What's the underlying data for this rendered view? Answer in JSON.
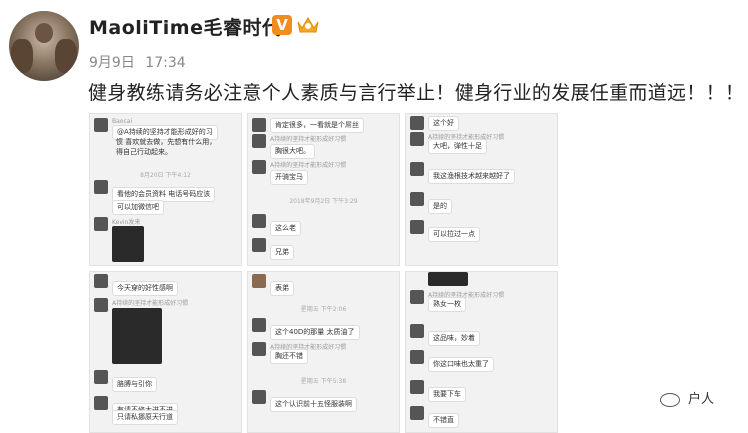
{
  "user": {
    "name": "MaoliTime毛睿时代",
    "verified_mark": "V"
  },
  "meta": {
    "date": "9月9日",
    "time": "17:34"
  },
  "post": {
    "text": "健身教练请务必注意个人素质与言行举止！健身行业的发展任重而道远！！！"
  },
  "screenshots": [
    {
      "msgs": [
        {
          "meta": "Baocai",
          "text": "@A持续的坚持才能形成好的习"
        },
        {
          "meta": "",
          "text": "惯 喜欢就去做，先想有什么用，"
        },
        {
          "meta": "",
          "text": "得自己行动起来。"
        },
        {
          "meta": "8月20日 下午4:12",
          "text": ""
        },
        {
          "meta": "",
          "text": "看他的会员资料 电话号码应该"
        },
        {
          "meta": "",
          "text": "可以加微信吧"
        },
        {
          "meta": "Kevin发来",
          "text": ""
        }
      ]
    },
    {
      "msgs": [
        {
          "meta": "",
          "text": "肯定很多，一看就是个屌丝"
        },
        {
          "meta": "A持续的坚持才能形成好习惯",
          "text": ""
        },
        {
          "meta": "",
          "text": "胸很大吧。"
        },
        {
          "meta": "A持续的坚持才能形成好习惯",
          "text": ""
        },
        {
          "meta": "",
          "text": "开骑宝马"
        },
        {
          "meta": "2018年9月2日 下午3:29",
          "text": ""
        },
        {
          "meta": "",
          "text": "这么老"
        },
        {
          "meta": "",
          "text": "兄弟"
        }
      ]
    },
    {
      "msgs": [
        {
          "meta": "",
          "text": "这个好"
        },
        {
          "meta": "A持续的坚持才能形成好习惯",
          "text": ""
        },
        {
          "meta": "",
          "text": "大吧，弹性十足"
        },
        {
          "meta": "",
          "text": "我这渔根技术越来越好了"
        },
        {
          "meta": "",
          "text": "是的"
        },
        {
          "meta": "",
          "text": "可以拉过一点"
        }
      ]
    },
    {
      "msgs": [
        {
          "meta": "",
          "text": "今天穿的好性感啊"
        },
        {
          "meta": "A持续的坚持才能形成好习惯",
          "text": ""
        },
        {
          "meta": "",
          "text": "胳膊与引你"
        },
        {
          "meta": "",
          "text": "有请不修大进不进"
        },
        {
          "meta": "",
          "text": "只请私挪原天行道"
        }
      ]
    },
    {
      "msgs": [
        {
          "meta": "",
          "text": "表弟"
        },
        {
          "meta": "星期五 下午2:06",
          "text": ""
        },
        {
          "meta": "",
          "text": "这个40D的那量 太质油了"
        },
        {
          "meta": "A持续的坚持才能形成好习惯",
          "text": ""
        },
        {
          "meta": "",
          "text": "胸还不错"
        },
        {
          "meta": "星期五 下午5:38",
          "text": ""
        },
        {
          "meta": "",
          "text": "这个认识前十五怪服装啊"
        }
      ]
    },
    {
      "msgs": [
        {
          "meta": "A持续的坚持才能形成好习惯",
          "text": ""
        },
        {
          "meta": "",
          "text": "熟女一枚"
        },
        {
          "meta": "",
          "text": "这品味，妙着"
        },
        {
          "meta": "",
          "text": "你这口味也太重了"
        },
        {
          "meta": "",
          "text": "我要下车"
        },
        {
          "meta": "",
          "text": "不错直"
        }
      ]
    }
  ],
  "watermark": {
    "text": "户人"
  }
}
